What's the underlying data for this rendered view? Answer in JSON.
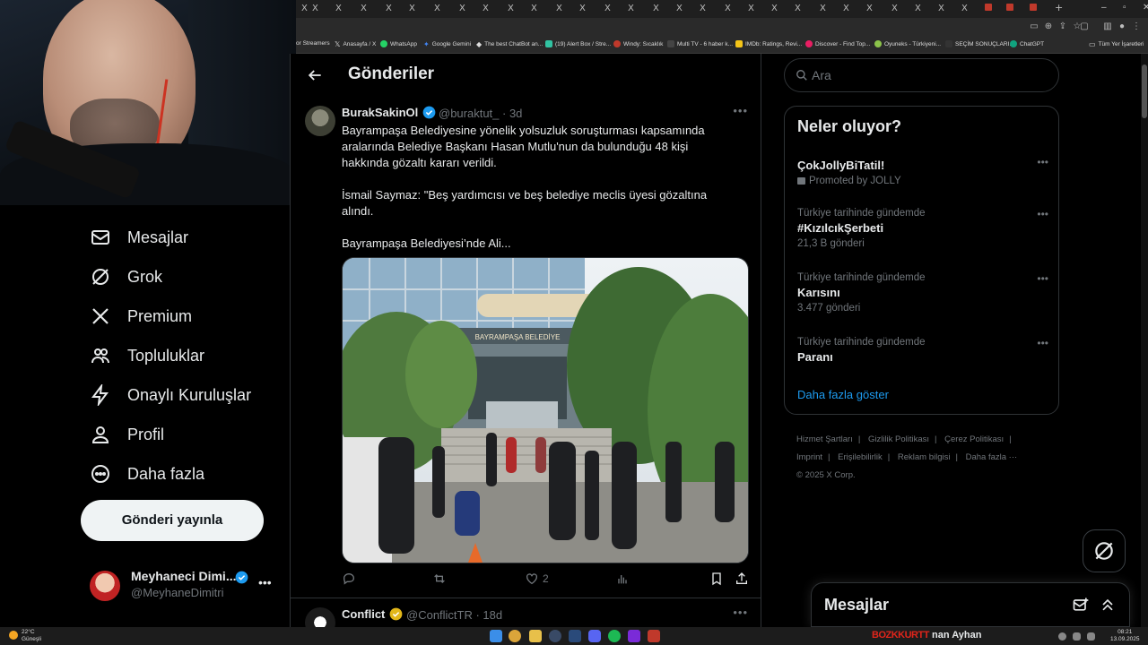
{
  "browser": {
    "tab_glyphs": [
      "X",
      "X",
      "X",
      "X",
      "X",
      "X",
      "X",
      "X",
      "X",
      "X",
      "X",
      "X",
      "X",
      "X",
      "X",
      "X",
      "X",
      "X",
      "X",
      "X",
      "X",
      "X",
      "X",
      "X",
      "X",
      "X",
      "X",
      "X",
      "X"
    ],
    "new_tab": "+",
    "bookmarks": [
      {
        "label": "or Streamers",
        "color": "#6b4fd8"
      },
      {
        "label": "Anasayfa / X",
        "color": "#000000"
      },
      {
        "label": "WhatsApp",
        "color": "#25d366"
      },
      {
        "label": "Google Gemini",
        "color": "#4285f4"
      },
      {
        "label": "The best ChatBot an...",
        "color": "#999999"
      },
      {
        "label": "(19) Alert Box / Stre...",
        "color": "#31c3a2"
      },
      {
        "label": "Windy: Sıcaklık",
        "color": "#c0392b"
      },
      {
        "label": "Multi TV - 6 haber k...",
        "color": "#444444"
      },
      {
        "label": "IMDb: Ratings, Revi...",
        "color": "#f5c518"
      },
      {
        "label": "Discover - Find Top...",
        "color": "#e91e63"
      },
      {
        "label": "Oyuneks - Türkiyeni...",
        "color": "#8bc34a"
      },
      {
        "label": "SEÇİM SONUÇLARI...",
        "color": "#333333"
      },
      {
        "label": "ChatGPT",
        "color": "#10a37f"
      },
      {
        "label": "Tüm Yer İşaretleri",
        "color": "#777777"
      }
    ]
  },
  "nav": {
    "items": [
      {
        "label": "Mesajlar",
        "icon": "mail-icon"
      },
      {
        "label": "Grok",
        "icon": "grok-icon"
      },
      {
        "label": "Premium",
        "icon": "x-logo-icon"
      },
      {
        "label": "Topluluklar",
        "icon": "communities-icon"
      },
      {
        "label": "Onaylı Kuruluşlar",
        "icon": "lightning-icon"
      },
      {
        "label": "Profil",
        "icon": "person-icon"
      },
      {
        "label": "Daha fazla",
        "icon": "more-circle-icon"
      }
    ],
    "post_button": "Gönderi yayınla",
    "account": {
      "name": "Meyhaneci Dimi...",
      "handle": "@MeyhaneDimitri",
      "more": "•••"
    }
  },
  "main": {
    "title": "Gönderiler",
    "tweet1": {
      "name": "BurakSakinOl",
      "handle": "@buraktut_ · 3d",
      "more": "•••",
      "text": [
        "Bayrampaşa Belediyesine yönelik yolsuzluk soruşturması kapsamında aralarında Belediye Başkanı Hasan Mutlu'nun da bulunduğu 48 kişi hakkında gözaltı kararı verildi.",
        "",
        "İsmail Saymaz:  \"Beş yardımcısı ve beş belediye meclis üyesi gözaltına alındı.",
        "",
        "Bayrampaşa Belediyesi’nde Ali..."
      ],
      "image_sign": "BAYRAMPAŞA BELEDİYE",
      "likes": "2"
    },
    "tweet2": {
      "name": "Conflict",
      "handle": "@ConflictTR · 18d",
      "more": "•••"
    }
  },
  "right": {
    "search_placeholder": "Ara",
    "trends_title": "Neler oluyor?",
    "trends": [
      {
        "context": "",
        "title": "ÇokJollyBiTatil!",
        "count": "Promoted by JOLLY",
        "promoted": true
      },
      {
        "context": "Türkiye tarihinde gündemde",
        "title": "#KızılcıkŞerbeti",
        "count": "21,3 B gönderi"
      },
      {
        "context": "Türkiye tarihinde gündemde",
        "title": "Karısını",
        "count": "3.477 gönderi"
      },
      {
        "context": "Türkiye tarihinde gündemde",
        "title": "Paranı",
        "count": ""
      }
    ],
    "show_more": "Daha fazla göster",
    "footer": [
      "Hizmet Şartları",
      "|",
      "Gizlilik Politikası",
      "|",
      "Çerez Politikası",
      "|",
      "Imprint",
      "|",
      "Erişilebilirlik",
      "|",
      "Reklam bilgisi",
      "|",
      "Daha fazla ···",
      "© 2025 X Corp."
    ],
    "messages_dock": "Mesajlar"
  },
  "taskbar": {
    "weather_temp": "22°C",
    "weather_desc": "Güneşli",
    "overlay_red": "BOZKKURTT",
    "overlay_name": "nan Ayhan",
    "time": "08:21",
    "date": "13.09.2025"
  },
  "colors": {
    "accent": "#1d9bf0",
    "verified": "#1d9bf0",
    "gold_badge": "#e2b719"
  }
}
